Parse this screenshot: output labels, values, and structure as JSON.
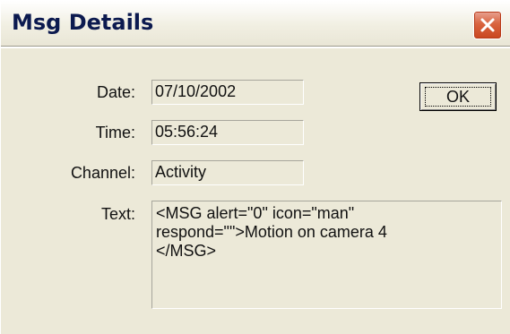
{
  "window": {
    "title": "Msg Details",
    "close_icon": "close-x-icon"
  },
  "fields": {
    "date_label": "Date:",
    "date_value": "07/10/2002",
    "time_label": "Time:",
    "time_value": "05:56:24",
    "channel_label": "Channel:",
    "channel_value": "Activity",
    "text_label": "Text:",
    "text_value": "<MSG alert=\"0\" icon=\"man\"\nrespond=\"\">Motion on camera 4\n</MSG>"
  },
  "buttons": {
    "ok_label": "OK"
  },
  "colors": {
    "dialog_background": "#ece9d8",
    "close_button": "#d9643f",
    "title_text": "#0c1a4f"
  }
}
